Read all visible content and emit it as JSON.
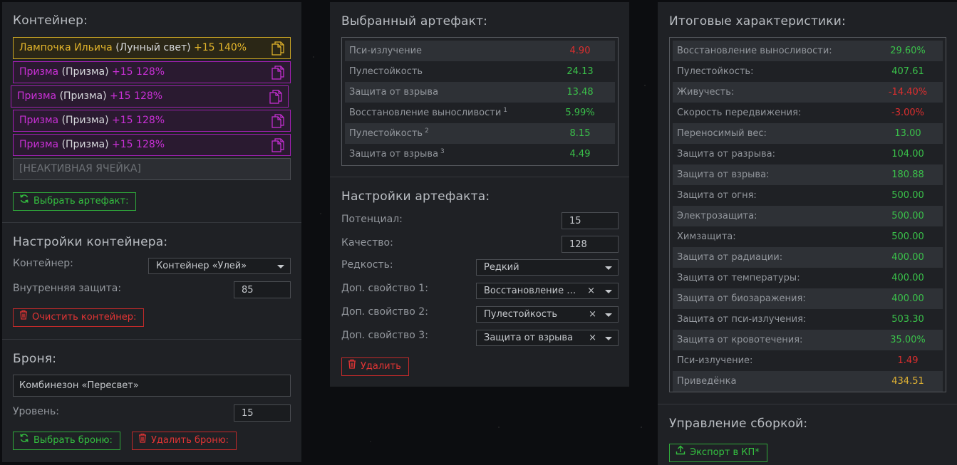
{
  "left": {
    "container_title": "Контейнер:",
    "slots": [
      {
        "name": "Лампочка Ильича",
        "base": "(Лунный свет)",
        "bonus": "+15 140%"
      },
      {
        "name": "Призма",
        "base": "(Призма)",
        "bonus": "+15 128%"
      },
      {
        "name": "Призма",
        "base": "(Призма)",
        "bonus": "+15 128%"
      },
      {
        "name": "Призма",
        "base": "(Призма)",
        "bonus": "+15 128%"
      },
      {
        "name": "Призма",
        "base": "(Призма)",
        "bonus": "+15 128%"
      }
    ],
    "inactive_slot": "[НЕАКТИВНАЯ ЯЧЕЙКА]",
    "select_artifact_btn": "Выбрать артефакт:",
    "container_settings_title": "Настройки контейнера:",
    "container_label": "Контейнер:",
    "container_value": "Контейнер «Улей»",
    "inner_protection_label": "Внутренняя защита:",
    "inner_protection_value": "85",
    "clear_container_btn": "Очистить контейнер:",
    "armor_title": "Броня:",
    "armor_value": "Комбинезон «Пересвет»",
    "level_label": "Уровень:",
    "level_value": "15",
    "select_armor_btn": "Выбрать броню:",
    "delete_armor_btn": "Удалить броню:"
  },
  "middle": {
    "selected_title": "Выбранный артефакт:",
    "stats": [
      {
        "label": "Пси-излучение",
        "sup": "",
        "value": "4.90",
        "color": "red"
      },
      {
        "label": "Пулестойкость",
        "sup": "",
        "value": "24.13",
        "color": "green"
      },
      {
        "label": "Защита от взрыва",
        "sup": "",
        "value": "13.48",
        "color": "green"
      },
      {
        "label": "Восстановление выносливости",
        "sup": "1",
        "value": "5.99%",
        "color": "green"
      },
      {
        "label": "Пулестойкость",
        "sup": "2",
        "value": "8.15",
        "color": "green"
      },
      {
        "label": "Защита от взрыва",
        "sup": "3",
        "value": "4.49",
        "color": "green"
      }
    ],
    "settings_title": "Настройки артефакта:",
    "potential_label": "Потенциал:",
    "potential_value": "15",
    "quality_label": "Качество:",
    "quality_value": "128",
    "rarity_label": "Редкость:",
    "rarity_value": "Редкий",
    "prop1_label": "Доп. свойство 1:",
    "prop1_value": "Восстановление выносливости",
    "prop2_label": "Доп. свойство 2:",
    "prop2_value": "Пулестойкость",
    "prop3_label": "Доп. свойство 3:",
    "prop3_value": "Защита от взрыва",
    "delete_btn": "Удалить"
  },
  "right": {
    "totals_title": "Итоговые характеристики:",
    "stats": [
      {
        "label": "Восстановление выносливости:",
        "value": "29.60%",
        "color": "green"
      },
      {
        "label": "Пулестойкость:",
        "value": "407.61",
        "color": "green"
      },
      {
        "label": "Живучесть:",
        "value": "-14.40%",
        "color": "red"
      },
      {
        "label": "Скорость передвижения:",
        "value": "-3.00%",
        "color": "red"
      },
      {
        "label": "Переносимый вес:",
        "value": "13.00",
        "color": "green"
      },
      {
        "label": "Защита от разрыва:",
        "value": "104.00",
        "color": "green"
      },
      {
        "label": "Защита от взрыва:",
        "value": "180.88",
        "color": "green"
      },
      {
        "label": "Защита от огня:",
        "value": "500.00",
        "color": "green"
      },
      {
        "label": "Электрозащита:",
        "value": "500.00",
        "color": "green"
      },
      {
        "label": "Химзащита:",
        "value": "500.00",
        "color": "green"
      },
      {
        "label": "Защита от радиации:",
        "value": "400.00",
        "color": "green"
      },
      {
        "label": "Защита от температуры:",
        "value": "400.00",
        "color": "green"
      },
      {
        "label": "Защита от биозаражения:",
        "value": "400.00",
        "color": "green"
      },
      {
        "label": "Защита от пси-излучения:",
        "value": "503.30",
        "color": "green"
      },
      {
        "label": "Защита от кровотечения:",
        "value": "35.00%",
        "color": "green"
      },
      {
        "label": "Пси-излучение:",
        "value": "1.49",
        "color": "red"
      },
      {
        "label": "Приведёнка",
        "value": "434.51",
        "color": "gold"
      }
    ],
    "build_title": "Управление сборкой:",
    "export_btn": "Экспорт в КП*"
  }
}
